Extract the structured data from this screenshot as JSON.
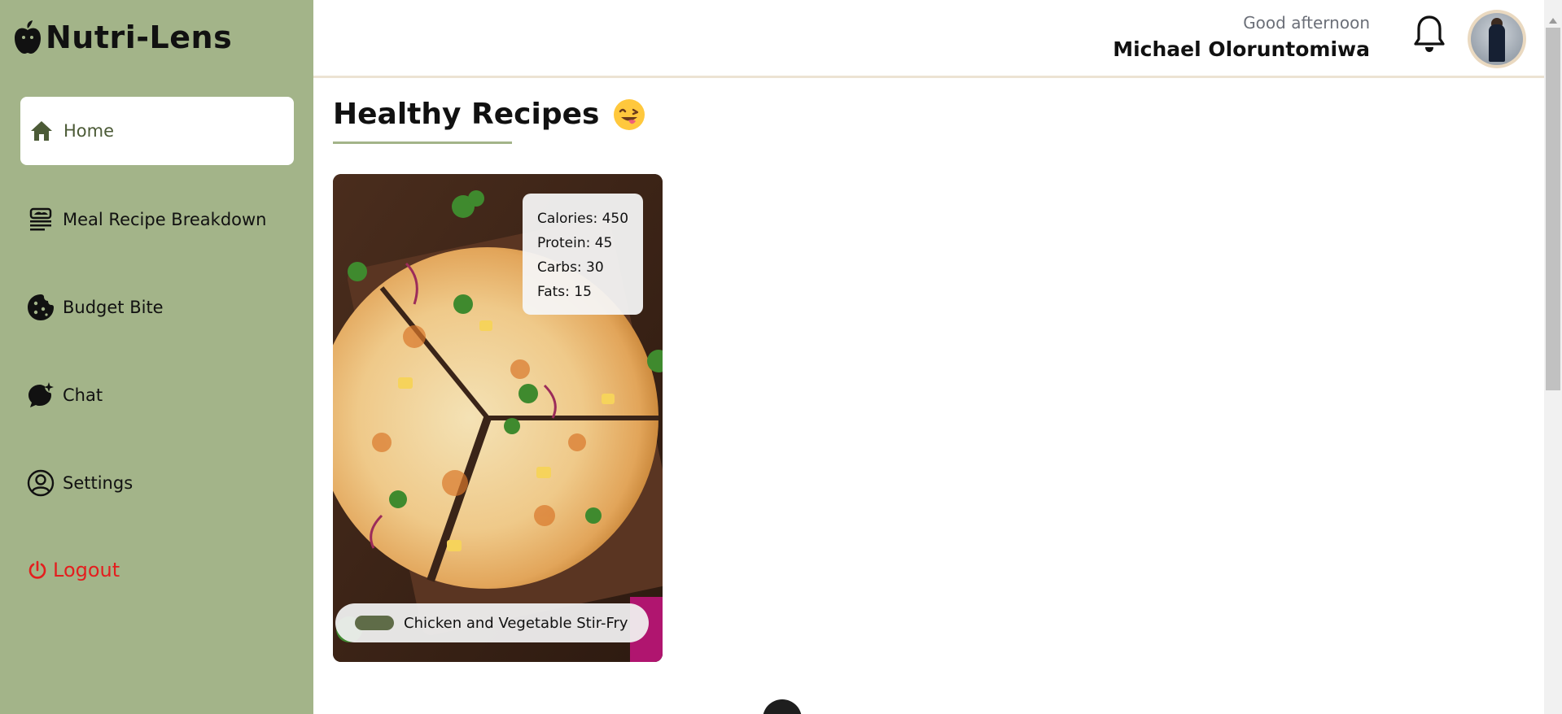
{
  "app": {
    "name": "Nutri-Lens"
  },
  "sidebar": {
    "items": [
      {
        "label": "Home",
        "icon": "home-icon",
        "active": true
      },
      {
        "label": "Meal Recipe Breakdown",
        "icon": "recipe-icon"
      },
      {
        "label": "Budget Bite",
        "icon": "cookie-icon"
      },
      {
        "label": "Chat",
        "icon": "chat-sparkle-icon"
      },
      {
        "label": "Settings",
        "icon": "user-circle-icon"
      },
      {
        "label": "Logout",
        "icon": "power-icon"
      }
    ]
  },
  "header": {
    "greeting": "Good afternoon",
    "user_name": "Michael Oloruntomiwa"
  },
  "main": {
    "title": "Healthy Recipes",
    "cards": [
      {
        "name": "Chicken and Vegetable Stir-Fry",
        "nutrition": {
          "calories": "Calories: 450",
          "protein": "Protein: 45",
          "carbs": "Carbs: 30",
          "fats": "Fats: 15"
        }
      }
    ]
  },
  "colors": {
    "sidebar": "#a3b489",
    "accent_dark": "#5f6c48",
    "logout": "#e41e1e"
  }
}
